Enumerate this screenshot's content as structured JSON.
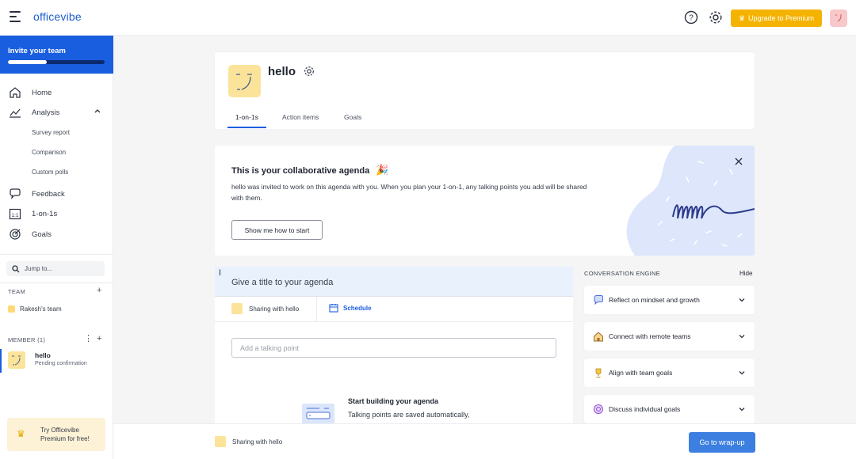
{
  "app": {
    "logo": "officevibe",
    "upgrade_label": "Upgrade to Premium"
  },
  "sidebar": {
    "invite_label": "Invite your team",
    "invite_progress": 0.4,
    "nav": [
      {
        "label": "Home",
        "icon": "home-icon"
      },
      {
        "label": "Analysis",
        "icon": "analysis-icon"
      },
      {
        "label": "Feedback",
        "icon": "feedback-icon"
      },
      {
        "label": "1-on-1s",
        "icon": "one-on-one-icon"
      },
      {
        "label": "Goals",
        "icon": "goals-icon"
      }
    ],
    "analysis_sub": [
      "Survey report",
      "Comparison",
      "Custom polls"
    ],
    "jump_placeholder": "Jump to...",
    "team_label": "TEAM",
    "team_item": "Rakesh's team",
    "member_label": "MEMBER (1)",
    "member_name": "hello",
    "member_status": "Pending confirmation",
    "premium_text": "Try Officevibe Premium for free!"
  },
  "profile": {
    "name": "hello",
    "tabs": [
      "1-on-1s",
      "Action items",
      "Goals"
    ],
    "active_tab": "1-on-1s"
  },
  "banner": {
    "title": "This is your collaborative agenda",
    "body": "hello was invited to work on this agenda with you. When you plan your 1-on-1, any talking points you add will be shared with them.",
    "button": "Show me how to start"
  },
  "agenda": {
    "title_placeholder": "Give a title to your agenda",
    "sharing_label": "Sharing with hello",
    "schedule_label": "Schedule",
    "talking_point_placeholder": "Add a talking point",
    "empty_title": "Start building your agenda",
    "empty_body": "Talking points are saved automatically,"
  },
  "conversation": {
    "heading": "CONVERSATION ENGINE",
    "hide_label": "Hide",
    "cards": [
      {
        "label": "Reflect on mindset and growth",
        "icon": "chat-icon"
      },
      {
        "label": "Connect with remote teams",
        "icon": "house-icon"
      },
      {
        "label": "Align with team goals",
        "icon": "trophy-icon"
      },
      {
        "label": "Discuss individual goals",
        "icon": "target-icon"
      }
    ]
  },
  "footer": {
    "sharing_label": "Sharing with hello",
    "wrap_up_label": "Go to wrap-up"
  },
  "colors": {
    "brand_blue": "#1a5ee0",
    "premium_yellow": "#f5b301",
    "avatar_yellow": "#fbe49a"
  }
}
